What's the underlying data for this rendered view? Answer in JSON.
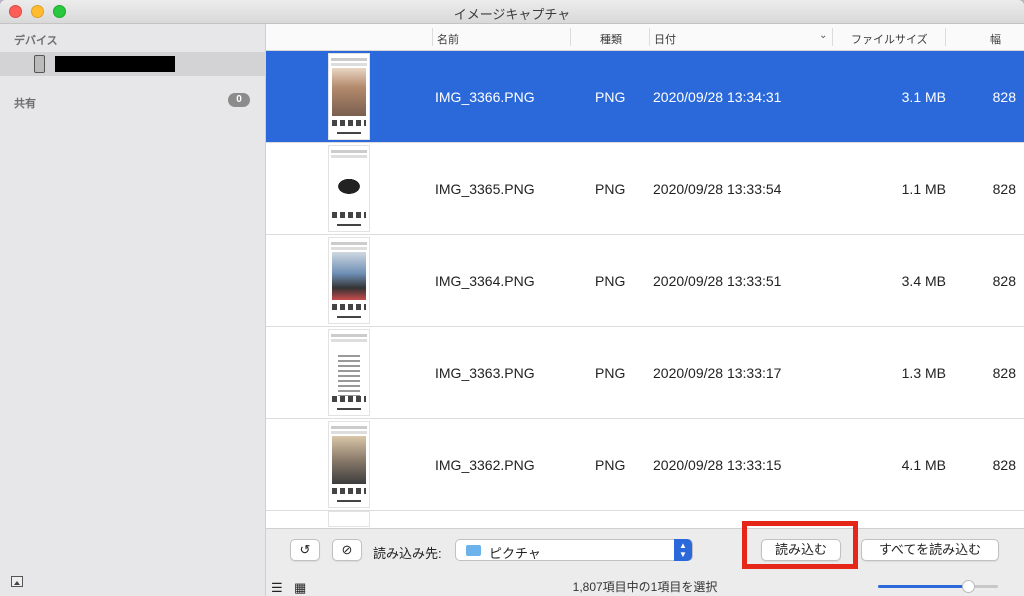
{
  "window": {
    "title": "イメージキャプチャ"
  },
  "sidebar": {
    "devices_label": "デバイス",
    "shared_label": "共有",
    "shared_count": "0"
  },
  "table": {
    "columns": [
      "名前",
      "種類",
      "日付",
      "ファイルサイズ",
      "幅"
    ],
    "rows": [
      {
        "name": "IMG_3366.PNG",
        "type": "PNG",
        "date": "2020/09/28 13:34:31",
        "size": "3.1 MB",
        "width": "828",
        "selected": true
      },
      {
        "name": "IMG_3365.PNG",
        "type": "PNG",
        "date": "2020/09/28 13:33:54",
        "size": "1.1 MB",
        "width": "828",
        "selected": false
      },
      {
        "name": "IMG_3364.PNG",
        "type": "PNG",
        "date": "2020/09/28 13:33:51",
        "size": "3.4 MB",
        "width": "828",
        "selected": false
      },
      {
        "name": "IMG_3363.PNG",
        "type": "PNG",
        "date": "2020/09/28 13:33:17",
        "size": "1.3 MB",
        "width": "828",
        "selected": false
      },
      {
        "name": "IMG_3362.PNG",
        "type": "PNG",
        "date": "2020/09/28 13:33:15",
        "size": "4.1 MB",
        "width": "828",
        "selected": false
      }
    ]
  },
  "bottom": {
    "destination_label": "読み込み先:",
    "destination_value": "ピクチャ",
    "import_button": "読み込む",
    "import_all_button": "すべてを読み込む",
    "status": "1,807項目中の1項目を選択",
    "thumbnail_size": 0.75
  },
  "colors": {
    "selection": "#2b69db",
    "highlight": "#e5271a"
  }
}
